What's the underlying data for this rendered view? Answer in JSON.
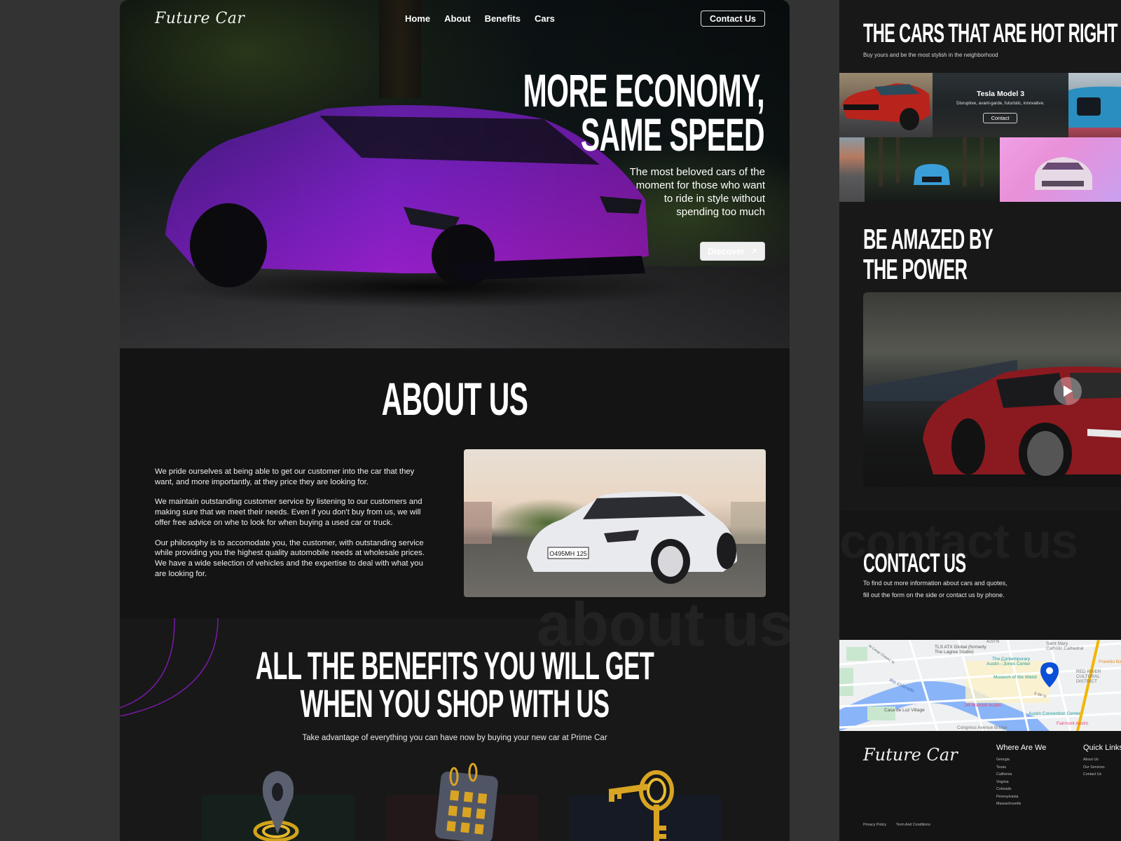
{
  "brand": {
    "name": "Future Car",
    "accent": "#7a1aa8"
  },
  "nav": {
    "links": [
      "Home",
      "About",
      "Benefits",
      "Cars"
    ],
    "contact_label": "Contact Us"
  },
  "hero": {
    "title_line1": "More Economy,",
    "title_line2": "Same Speed",
    "subtitle": "The most beloved cars of the moment for those who want to ride in style without spending too much",
    "button_label": "Discover",
    "button_icon": "arrow-up-right-icon"
  },
  "about": {
    "title": "About Us",
    "paragraphs": [
      "We pride ourselves at being able to get our customer into the car that they want, and more importantly, at they price they are looking for.",
      "We maintain outstanding customer service by listening to our customers and making sure that we meet their needs. Even if you don't buy from us, we will offer free advice on whe to look for when buying a used car or truck.",
      "Our philosophy is to accomodate you, the customer, with outstanding service while providing you the highest quality automobile needs at wholesale prices. We have a wide selection of vehicles and the expertise to deal with what you are looking for."
    ],
    "watermark": "about us",
    "plate": "O495MH 125"
  },
  "benefits": {
    "title_line1": "All the benefits you will get",
    "title_line2": "when you shop with us",
    "subtitle": "Take advantage of everything you can have now by buying your new car at Prime Car",
    "cards": [
      {
        "icon": "location-pin-icon",
        "color": "#15201c"
      },
      {
        "icon": "calendar-icon",
        "color": "#231819"
      },
      {
        "icon": "keys-icon",
        "color": "#161a24"
      }
    ]
  },
  "hot_cars": {
    "title": "The cars that are hot right now",
    "subtitle": "Buy yours and be the most stylish in the neighborhood",
    "featured": {
      "name": "Tesla Model 3",
      "description": "Disruptive, avant-garde, futuristic, innovative.",
      "button_label": "Contact"
    }
  },
  "power": {
    "title_line1": "Be amazed by",
    "title_line2": "the power",
    "play_icon": "play-icon"
  },
  "contact": {
    "title": "Contact Us",
    "watermark": "contact us",
    "subtitle_line1": "To find out more information about cars and quotes,",
    "subtitle_line2": "fill out the form on the side or contact us by phone."
  },
  "map": {
    "labels": [
      "TLS ATX Global (formerly",
      "The Lagree Studio)",
      "Saint Mary",
      "Catholic Cathedral",
      "The Contemporary",
      "Austin - Jones Center",
      "Museum of the Weird",
      "RED RIVER",
      "CULTURAL",
      "DISTRICT",
      "Rio Colorado",
      "W Cesar Chavez St",
      "E 5th St",
      "JW Marriott Austin",
      "Casa de Luz Village",
      "Austin Convention Center",
      "Fairmont Austin",
      "Congress Avenue Bridge",
      "Franklin Ba",
      "AUSTIN"
    ]
  },
  "footer": {
    "where_title": "Where Are We",
    "where_items": [
      "Georgia",
      "Texas",
      "California",
      "Virginia",
      "Colorado",
      "Pennsylvania",
      "Massachusetts"
    ],
    "links_title": "Quick Links",
    "links_items": [
      "About Us",
      "Our Services",
      "Contact Us"
    ],
    "bottom_links": [
      "Privacy Policy",
      "Term And Conditions"
    ]
  }
}
